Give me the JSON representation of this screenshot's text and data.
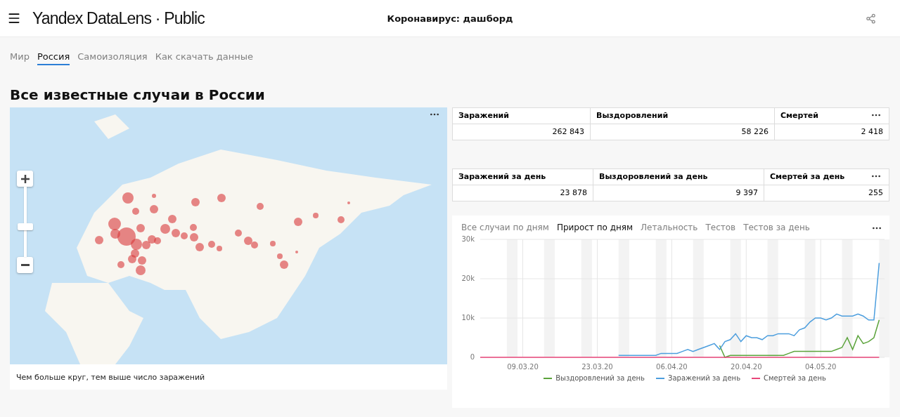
{
  "header": {
    "logo": "Yandex DataLens · Public",
    "title": "Коронавирус: дашборд"
  },
  "tabs": [
    {
      "label": "Мир",
      "selected": false
    },
    {
      "label": "Россия",
      "selected": true
    },
    {
      "label": "Самоизоляция",
      "selected": false
    },
    {
      "label": "Как скачать данные",
      "selected": false
    }
  ],
  "section_title": "Все известные случаи в России",
  "map": {
    "caption": "Чем больше круг, тем выше число заражений"
  },
  "tables": [
    {
      "columns": [
        "Заражений",
        "Выздоровлений",
        "Смертей"
      ],
      "values": [
        "262 843",
        "58 226",
        "2 418"
      ]
    },
    {
      "columns": [
        "Заражений за день",
        "Выздоровлений за день",
        "Смертей за день"
      ],
      "values": [
        "23 878",
        "9 397",
        "255"
      ]
    }
  ],
  "chart": {
    "tabs": [
      {
        "label": "Все случаи по дням",
        "selected": false
      },
      {
        "label": "Прирост по дням",
        "selected": true
      },
      {
        "label": "Летальность",
        "selected": false
      },
      {
        "label": "Тестов",
        "selected": false
      },
      {
        "label": "Тестов за день",
        "selected": false
      }
    ],
    "chart_data": {
      "type": "line",
      "categories": [
        null,
        null,
        null,
        null,
        null,
        null,
        null,
        null,
        "09.03.20",
        null,
        null,
        null,
        null,
        null,
        null,
        null,
        null,
        null,
        null,
        null,
        null,
        null,
        "23.03.20",
        null,
        null,
        null,
        null,
        null,
        null,
        null,
        null,
        null,
        null,
        null,
        null,
        null,
        "06.04.20",
        null,
        null,
        null,
        null,
        null,
        null,
        null,
        null,
        null,
        null,
        null,
        null,
        null,
        "20.04.20",
        null,
        null,
        null,
        null,
        null,
        null,
        null,
        null,
        null,
        null,
        null,
        null,
        null,
        "04.05.20",
        null,
        null,
        null,
        null,
        null,
        null,
        null,
        null,
        null,
        null,
        null
      ],
      "ylim": [
        0,
        30000
      ],
      "grid": true,
      "yticks": [
        {
          "value": 0,
          "label": "0"
        },
        {
          "value": 10000,
          "label": "10k"
        },
        {
          "value": 20000,
          "label": "20k"
        },
        {
          "value": 30000,
          "label": "30k"
        }
      ],
      "series": [
        {
          "name": "Выздоровлений за день",
          "color": "#5ba33b",
          "values": [
            null,
            null,
            null,
            null,
            null,
            null,
            null,
            null,
            null,
            null,
            null,
            null,
            null,
            null,
            null,
            null,
            null,
            null,
            null,
            null,
            null,
            null,
            null,
            null,
            null,
            null,
            null,
            null,
            null,
            null,
            null,
            null,
            null,
            null,
            null,
            null,
            null,
            null,
            null,
            null,
            null,
            null,
            null,
            null,
            null,
            3000,
            0,
            500,
            500,
            500,
            500,
            500,
            500,
            500,
            500,
            500,
            500,
            500,
            1000,
            1500,
            1500,
            1500,
            1500,
            1500,
            1500,
            1500,
            1500,
            2000,
            2500,
            5000,
            2000,
            5500,
            3500,
            4000,
            5000,
            9500
          ]
        },
        {
          "name": "Заражений за день",
          "color": "#4c9ede",
          "values": [
            null,
            null,
            null,
            null,
            null,
            null,
            null,
            null,
            null,
            null,
            null,
            null,
            null,
            null,
            null,
            null,
            null,
            null,
            null,
            null,
            null,
            null,
            null,
            null,
            null,
            null,
            500,
            500,
            500,
            500,
            500,
            500,
            500,
            500,
            1000,
            1000,
            1000,
            1000,
            1500,
            2000,
            1500,
            2000,
            2500,
            3000,
            3500,
            2000,
            4000,
            4500,
            6000,
            4000,
            5500,
            5000,
            5000,
            4500,
            5500,
            5500,
            6000,
            6000,
            6000,
            5500,
            7000,
            7500,
            9000,
            10000,
            10000,
            9500,
            10000,
            11000,
            10500,
            10500,
            10500,
            11000,
            10500,
            9500,
            9500,
            24000
          ]
        },
        {
          "name": "Смертей за день",
          "color": "#e8467a",
          "values": [
            0,
            0,
            0,
            0,
            0,
            0,
            0,
            0,
            0,
            0,
            0,
            0,
            0,
            0,
            0,
            0,
            0,
            0,
            0,
            0,
            0,
            0,
            0,
            0,
            0,
            0,
            0,
            0,
            0,
            0,
            0,
            0,
            0,
            0,
            0,
            0,
            0,
            0,
            0,
            0,
            0,
            0,
            0,
            0,
            0,
            0,
            0,
            0,
            0,
            0,
            0,
            0,
            0,
            0,
            0,
            0,
            0,
            0,
            0,
            0,
            0,
            0,
            0,
            0,
            0,
            0,
            0,
            0,
            0,
            0,
            0,
            0,
            0,
            0,
            0,
            0
          ]
        }
      ]
    }
  }
}
